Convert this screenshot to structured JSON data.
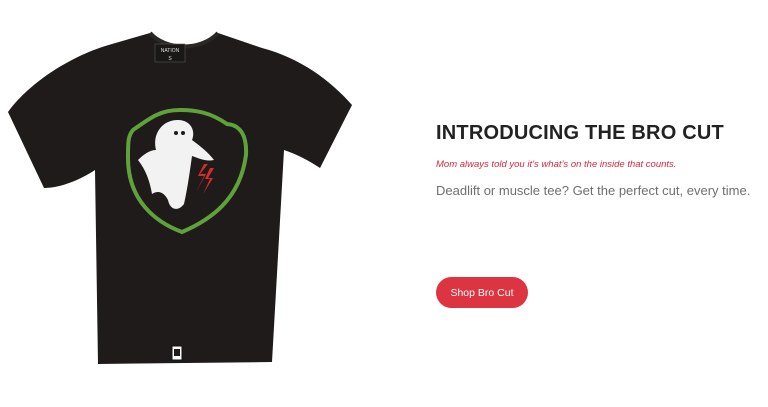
{
  "product": {
    "image_name": "black-tshirt-with-ghost-shield-graphic",
    "neck_label_text": "NATION",
    "size_text": "S",
    "colors": {
      "shirt": "#1e1b1a",
      "shield_border": "#5fa23a",
      "ghost": "#f2f2f2",
      "lightning": "#d62c2c"
    }
  },
  "promo": {
    "title": "INTRODUCING THE BRO CUT",
    "tagline": "Mom always told you it’s what’s on the inside that counts.",
    "description": "Deadlift or muscle tee? Get the perfect cut, every time.",
    "cta_label": "Shop Bro Cut",
    "accent_color": "#dc3441"
  }
}
